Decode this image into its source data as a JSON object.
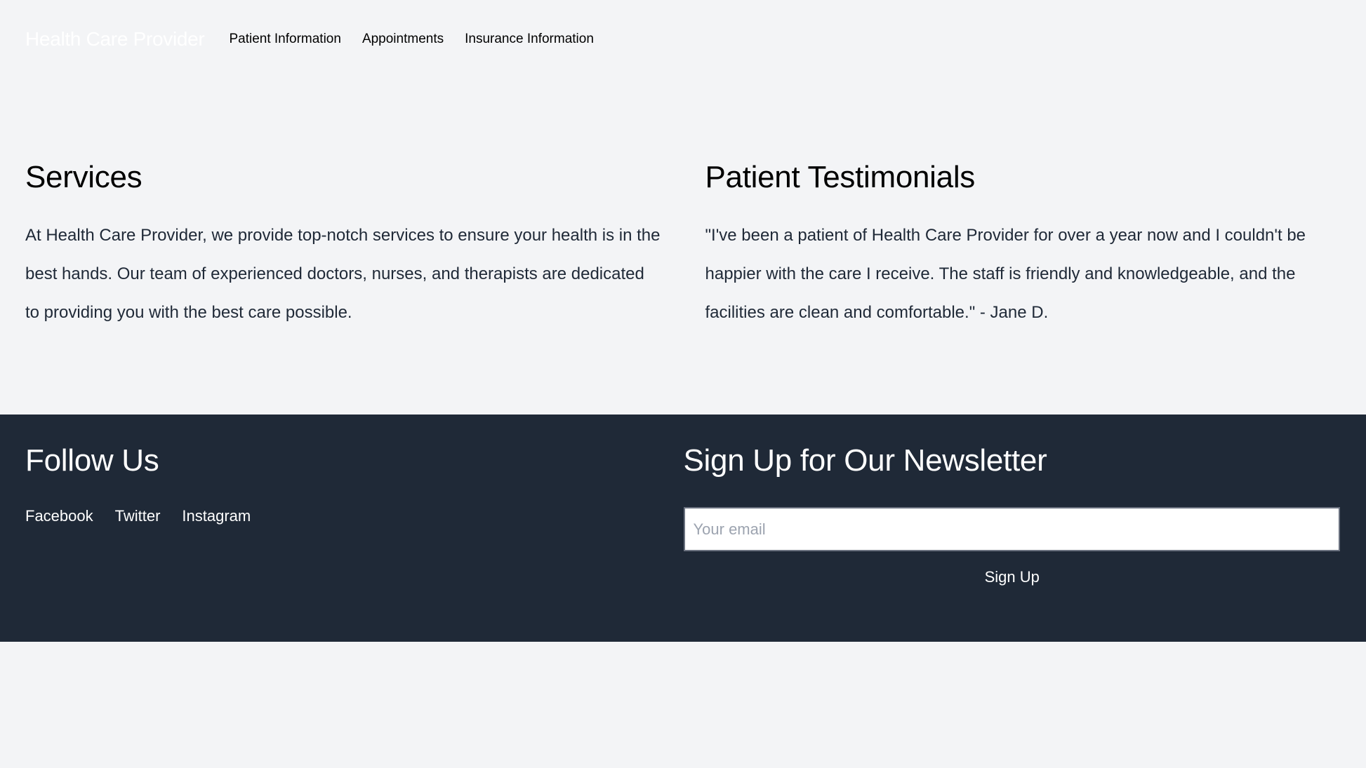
{
  "header": {
    "logo": "Health Care Provider",
    "nav": [
      {
        "label": "Patient Information"
      },
      {
        "label": "Appointments"
      },
      {
        "label": "Insurance Information"
      }
    ]
  },
  "main": {
    "services": {
      "title": "Services",
      "body": "At Health Care Provider, we provide top-notch services to ensure your health is in the best hands. Our team of experienced doctors, nurses, and therapists are dedicated to providing you with the best care possible."
    },
    "testimonials": {
      "title": "Patient Testimonials",
      "body": "\"I've been a patient of Health Care Provider for over a year now and I couldn't be happier with the care I receive. The staff is friendly and knowledgeable, and the facilities are clean and comfortable.\" - Jane D."
    }
  },
  "footer": {
    "follow": {
      "title": "Follow Us",
      "links": [
        {
          "label": "Facebook"
        },
        {
          "label": "Twitter"
        },
        {
          "label": "Instagram"
        }
      ]
    },
    "newsletter": {
      "title": "Sign Up for Our Newsletter",
      "email_placeholder": "Your email",
      "email_value": "",
      "button_label": "Sign Up"
    }
  },
  "colors": {
    "page_background": "#f3f4f6",
    "footer_background": "#1f2937",
    "body_text": "#1f2937",
    "heading_text": "#000000",
    "footer_text": "#ffffff",
    "placeholder_text": "#9ca3af"
  }
}
